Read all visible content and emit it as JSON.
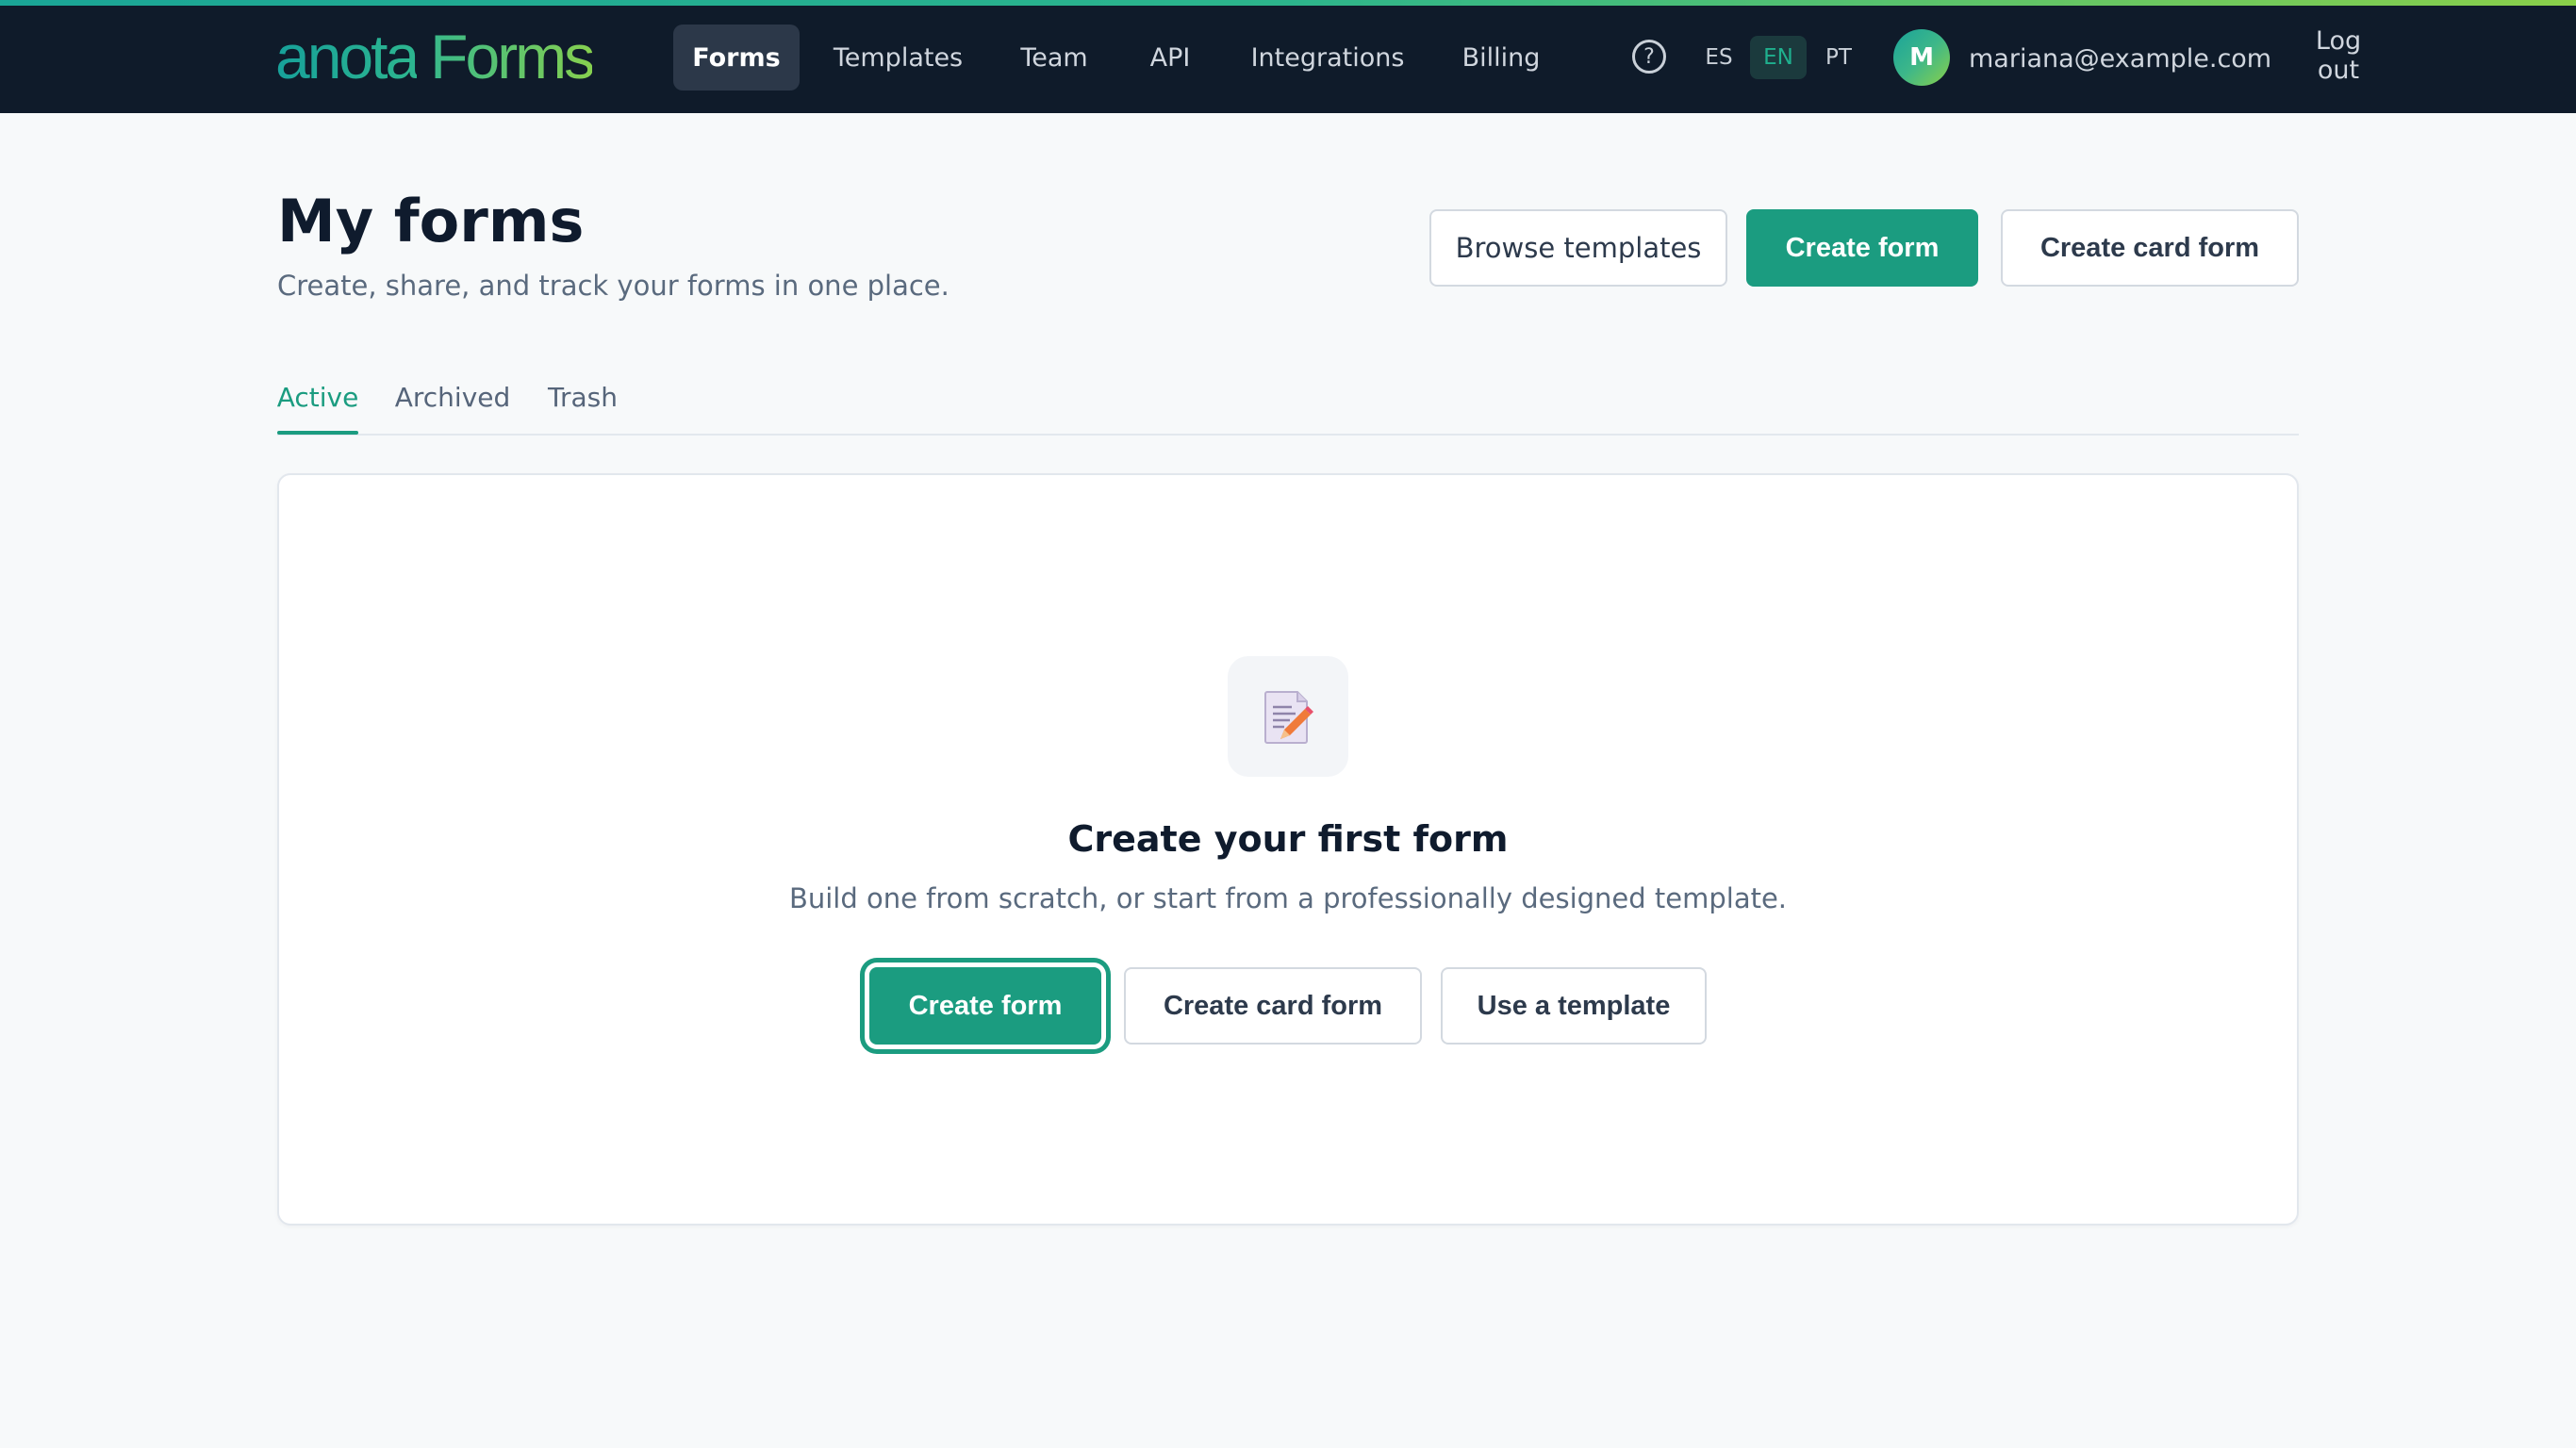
{
  "brand": {
    "logo_part1": "anota",
    "logo_part2": "Forms",
    "colors": {
      "topbar": "#0f1b2a",
      "accent": "#1b9c80",
      "gradient_start": "#1aa596",
      "gradient_end": "#8ad04a"
    }
  },
  "nav": {
    "items": [
      {
        "label": "Forms",
        "active": true
      },
      {
        "label": "Templates",
        "active": false
      },
      {
        "label": "Team",
        "active": false
      },
      {
        "label": "API",
        "active": false
      },
      {
        "label": "Integrations",
        "active": false
      },
      {
        "label": "Billing",
        "active": false
      }
    ],
    "help_icon": "question-circle-icon",
    "help_glyph": "?",
    "languages": [
      {
        "label": "ES",
        "active": false
      },
      {
        "label": "EN",
        "active": true
      },
      {
        "label": "PT",
        "active": false
      }
    ],
    "user": {
      "avatar_initial": "M",
      "email": "mariana@example.com"
    },
    "logout_label": "Log out"
  },
  "header": {
    "title": "My forms",
    "subtitle": "Create, share, and track your forms in one place.",
    "actions": {
      "browse_templates": "Browse templates",
      "create_form": "Create form",
      "create_card_form": "Create card form"
    }
  },
  "tabs": [
    {
      "label": "Active",
      "active": true
    },
    {
      "label": "Archived",
      "active": false
    },
    {
      "label": "Trash",
      "active": false
    }
  ],
  "empty_state": {
    "icon": "form-edit-icon",
    "title": "Create your first form",
    "subtitle": "Build one from scratch, or start from a professionally designed template.",
    "actions": {
      "create_form": "Create form",
      "create_card_form": "Create card form",
      "use_template": "Use a template"
    }
  }
}
